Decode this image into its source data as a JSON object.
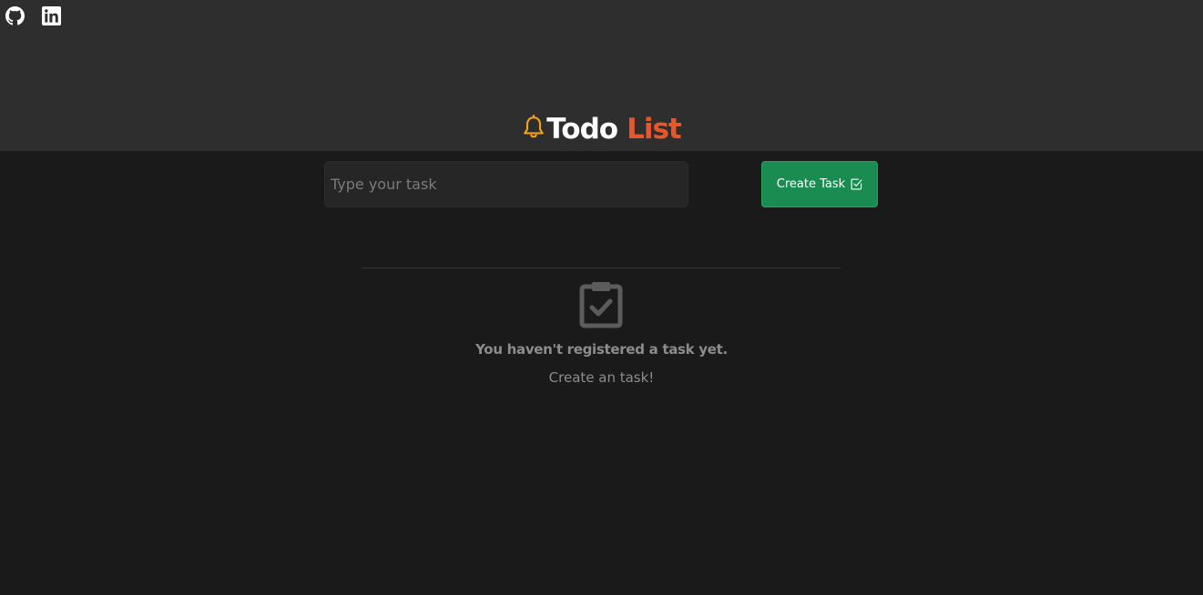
{
  "header": {
    "title_part1": "Todo",
    "title_part2": "List",
    "accent_color": "#e8572c",
    "bell_color": "#f0a020",
    "social_links": [
      "github-icon",
      "linkedin-icon"
    ]
  },
  "form": {
    "task_placeholder": "Type your task",
    "task_value": "",
    "create_label": "Create Task",
    "create_button_color": "#1a8c52"
  },
  "empty_state": {
    "icon": "clipboard-check-icon",
    "title": "You haven't registered a task yet.",
    "subtitle": "Create an task!"
  }
}
